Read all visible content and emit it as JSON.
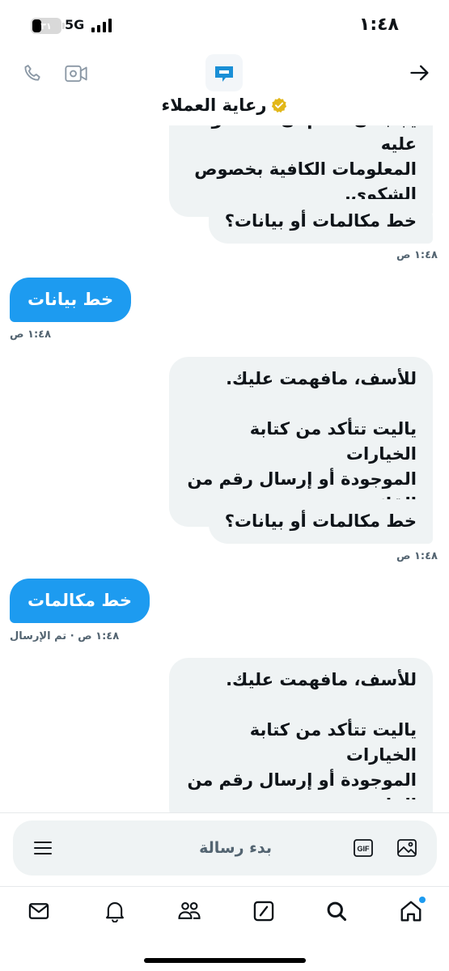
{
  "status_bar": {
    "time": "١:٤٨",
    "network": "5G",
    "battery_text": "٣١",
    "battery_level": 0.31
  },
  "header": {
    "contact_name": "رعاية العملاء",
    "icons": {
      "back": "arrow-right-icon",
      "phone": "phone-icon",
      "video": "video-icon",
      "verified": "verified-badge-icon",
      "logo": "company-logo-icon"
    }
  },
  "messages": [
    {
      "direction": "incoming",
      "text": "يجب أن تقدم أن المقصود عليه\nالمعلومات الكافية بخصوص\nالشكوى.",
      "time": ""
    },
    {
      "direction": "incoming",
      "text": "خط مكالمات أو بيانات؟",
      "time": "١:٤٨ ص"
    },
    {
      "direction": "outgoing",
      "text": "خط بيانات",
      "time": "١:٤٨ ص"
    },
    {
      "direction": "incoming",
      "text": "للأسف، مافهمت عليك.\n\nياليت تتأكد من كتابة الخيارات\nالموجودة أو إرسال رقم من\nالقائمة.",
      "time": ""
    },
    {
      "direction": "incoming",
      "text": "خط مكالمات أو بيانات؟",
      "time": "١:٤٨ ص"
    },
    {
      "direction": "outgoing",
      "text": "خط مكالمات",
      "time": "١:٤٨ ص · تم الإرسال"
    },
    {
      "direction": "incoming",
      "text": "للأسف، مافهمت عليك.\n\nياليت تتأكد من كتابة الخيارات\nالموجودة أو إرسال رقم من\nالقائمة.",
      "time": ""
    }
  ],
  "composer": {
    "placeholder": "بدء رسالة",
    "gif_label": "GIF",
    "icons": {
      "menu": "menu-icon",
      "gif": "gif-icon",
      "image": "image-icon"
    }
  },
  "bottom_nav": {
    "items": [
      {
        "name": "home",
        "icon": "home-icon",
        "has_notification_dot": true
      },
      {
        "name": "search",
        "icon": "search-icon"
      },
      {
        "name": "grok",
        "icon": "grok-icon"
      },
      {
        "name": "communities",
        "icon": "people-icon"
      },
      {
        "name": "notifications",
        "icon": "bell-icon"
      },
      {
        "name": "messages",
        "icon": "mail-icon"
      }
    ]
  },
  "colors": {
    "accent": "#1d9bf0",
    "incoming_bubble": "#eff3f4",
    "text_primary": "#0f1419",
    "text_secondary": "#536471",
    "verified_gold": "#e2b719",
    "logo_blue": "#1a8fd6"
  }
}
